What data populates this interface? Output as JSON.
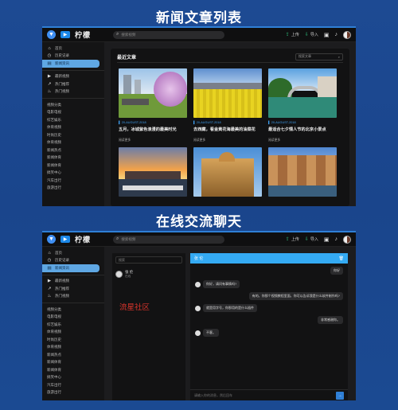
{
  "titles": {
    "top": "新闻文章列表",
    "bottom": "在线交流聊天"
  },
  "app": {
    "name": "柠檬",
    "search_placeholder": "搜索视频",
    "upload": "上传",
    "import": "导入"
  },
  "sidebar": {
    "group1": [
      {
        "icon": "home-icon",
        "glyph": "⌂",
        "label": "首页"
      },
      {
        "icon": "history-icon",
        "glyph": "◷",
        "label": "历史记录"
      },
      {
        "icon": "news-icon",
        "glyph": "▤",
        "label": "新闻资讯"
      }
    ],
    "group2": [
      {
        "icon": "video-icon",
        "glyph": "▶",
        "label": "最新视频"
      },
      {
        "icon": "trend-icon",
        "glyph": "↗",
        "label": "热门推荐"
      },
      {
        "icon": "flame-icon",
        "glyph": "♨",
        "label": "热门视频"
      }
    ],
    "categories": [
      "视频分类",
      "电影电视",
      "综艺娱乐",
      "体育视频",
      "时尚历史",
      "体育视频",
      "新闻热点",
      "新闻体育",
      "新闻体育",
      "搞笑中心",
      "汽车出行",
      "旅游出行"
    ]
  },
  "news": {
    "panel_title": "最近文章",
    "search_placeholder": "搜索文章",
    "cards": [
      {
        "date": "20-AUGUST-2018",
        "title": "五月，冰城紫色浪漫的最美时光",
        "more": "阅读更多"
      },
      {
        "date": "20-AUGUST-2018",
        "title": "去西藏，看金黄花海最美的油菜花",
        "more": "阅读更多"
      },
      {
        "date": "20-AUGUST-2018",
        "title": "最适合七夕情人节的北京小景点",
        "more": "阅读更多"
      },
      {
        "date": "",
        "title": "",
        "more": ""
      },
      {
        "date": "",
        "title": "",
        "more": ""
      },
      {
        "date": "",
        "title": "",
        "more": ""
      }
    ]
  },
  "chat": {
    "search_placeholder": "搜索",
    "contact": {
      "name": "张 伦",
      "status": "在线"
    },
    "header": "张 伦",
    "messages": [
      {
        "side": "right",
        "text": "你好"
      },
      {
        "side": "left",
        "text": "你好，请问有事情吗?"
      },
      {
        "side": "right",
        "text": "有的，你那个视频教程里面，你可以告诉我是什么软件制作吗?"
      },
      {
        "side": "left",
        "text": "就是用字号，你那用的是什么插件"
      },
      {
        "side": "right",
        "text": "非常感谢你。"
      },
      {
        "side": "left",
        "text": "不客。"
      }
    ],
    "input_placeholder": "请输入你的消息，然后回车",
    "send": "→"
  },
  "watermark": "流星社区"
}
